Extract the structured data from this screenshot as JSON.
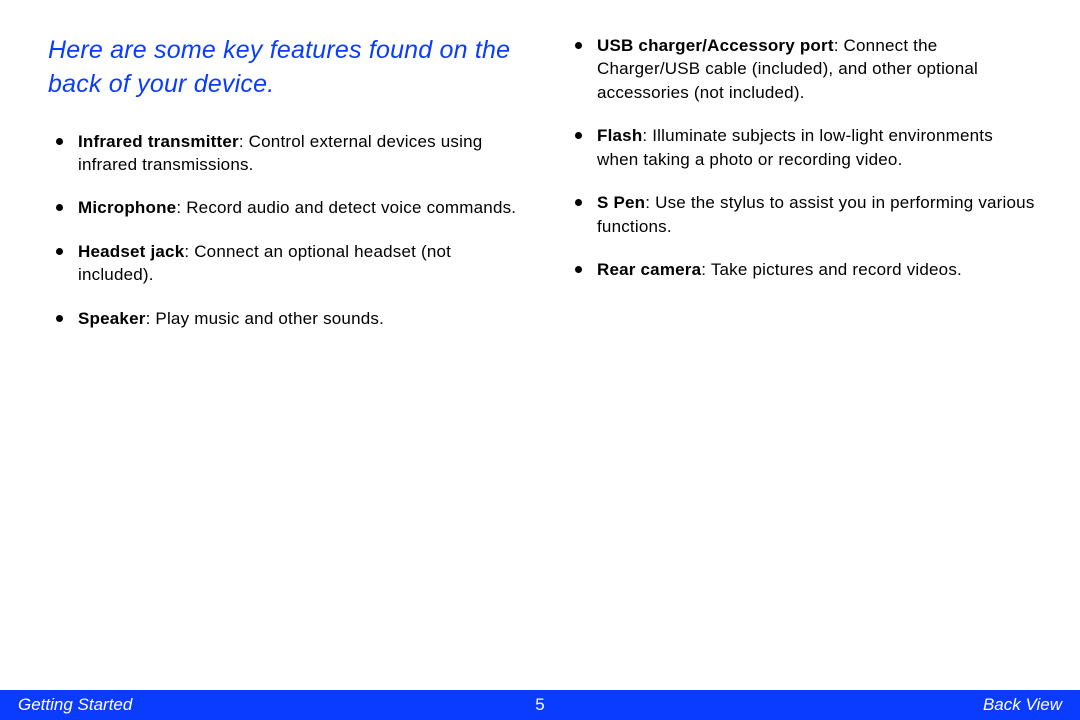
{
  "heading": "Here are some key features found on the back of your device.",
  "left": [
    {
      "term": "Infrared transmitter",
      "desc": ": Control external devices using infrared transmissions."
    },
    {
      "term": "Microphone",
      "desc": ": Record audio and detect voice commands."
    },
    {
      "term": "Headset jack",
      "desc": ": Connect an optional headset (not included)."
    },
    {
      "term": "Speaker",
      "desc": ": Play music and other sounds."
    }
  ],
  "right": [
    {
      "term": "USB charger/Accessory port",
      "desc": ": Connect the Charger/USB cable (included), and other optional accessories (not included)."
    },
    {
      "term": "Flash",
      "desc": ": Illuminate subjects in low-light environments when taking a photo or recording video."
    },
    {
      "term": "S Pen",
      "desc": ": Use the stylus to assist you in performing various functions."
    },
    {
      "term": "Rear camera",
      "desc": ": Take pictures and record videos."
    }
  ],
  "footer": {
    "left": "Getting Started",
    "center": "5",
    "right": "Back View"
  }
}
